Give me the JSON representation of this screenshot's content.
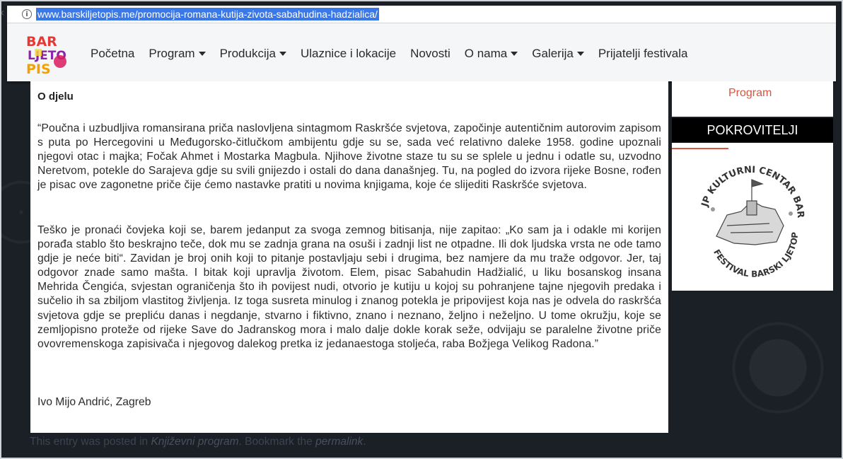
{
  "browser": {
    "url": "www.barskiljetopis.me/promocija-romana-kutija-zivota-sabahudina-hadzialica/"
  },
  "site": {
    "logo_text": [
      "BAR",
      "LJETO",
      "PIS"
    ],
    "nav": [
      {
        "label": "Početna",
        "dropdown": false
      },
      {
        "label": "Program",
        "dropdown": true
      },
      {
        "label": "Produkcija",
        "dropdown": true
      },
      {
        "label": "Ulaznice i lokacije",
        "dropdown": false
      },
      {
        "label": "Novosti",
        "dropdown": false
      },
      {
        "label": "O nama",
        "dropdown": true
      },
      {
        "label": "Galerija",
        "dropdown": true
      },
      {
        "label": "Prijatelji festivala",
        "dropdown": false
      }
    ]
  },
  "article": {
    "heading": "O djelu",
    "paragraph1": "“Poučna i uzbudljiva romansirana priča naslovljena sintagmom Raskršće svjetova, započinje autentičnim autorovim zapisom s puta po Hercegovini u Međugorsko-čitlučkom ambijentu gdje su se, sada već relativno daleke 1958. godine upoznali njegovi otac i majka; Fočak Ahmet i Mostarka Magbula. Njihove životne staze tu su se splele u jednu i odatle su,  uzvodno Neretvom, potekle do Sarajeva gdje su svili gnijezdo i ostali do dana današnjeg. Tu, na pogled do izvora rijeke Bosne, rođen je pisac ove zagonetne priče čije ćemo nastavke pratiti u novima knjigama, koje će slijediti Raskršće svjetova.",
    "paragraph2": "Teško je pronaći čovjeka koji se, barem jedanput za svoga zemnog bitisanja, nije zapitao: „Ko sam ja i odakle mi korijen porađa stablo što beskrajno teče, dok mu se zadnja grana na osuši i zadnji list ne otpadne. Ili dok ljudska vrsta ne ode tamo gdje je neće biti“. Zavidan je broj onih koji to pitanje postavljaju sebi i drugima, bez namjere da mu traže odgovor. Jer, taj odgovor znade samo mašta. I bitak koji upravlja životom. Elem, pisac Sabahudin Hadžialić, u liku bosanskog insana Mehrida Čengića, svjestan ograničenja što ih povijest nudi, otvorio je kutiju u kojoj su pohranjene tajne njegovih predaka i sučelio ih sa zbiljom vlastitog življenja. Iz toga susreta minulog i znanog potekla je pripovijest koja nas je odvela do raskršća svjetova gdje se prepliću danas i negdanje, stvarno i fiktivno, znano i neznano, željno i neželjno. U tome okružju, koje se zemljopisno proteže od rijeke Save do Jadranskog mora i malo dalje dokle korak seže, odvijaju se paralelne životne priče ovovremenskoga zapisivača i njegovog dalekog pretka iz jedanaestoga stoljeća, raba Božjega Velikog Radona.”",
    "signature": "Ivo Mijo Andrić, Zagreb"
  },
  "footer": {
    "prefix": "This entry was posted in ",
    "category": "Književni program",
    "middle": ". Bookmark the ",
    "permalink": "permalink",
    "suffix": "."
  },
  "sidebar": {
    "program_link": "Program",
    "sponsors_title": "POKROVITELJI",
    "sponsor_logo_top": "JP KULTURNI CENTAR BAR",
    "sponsor_logo_bottom": "FESTIVAL BARSKI LJETOPIS"
  },
  "colors": {
    "accent": "#d9553f",
    "background": "#1b2027",
    "url_highlight": "#3b78e7"
  }
}
